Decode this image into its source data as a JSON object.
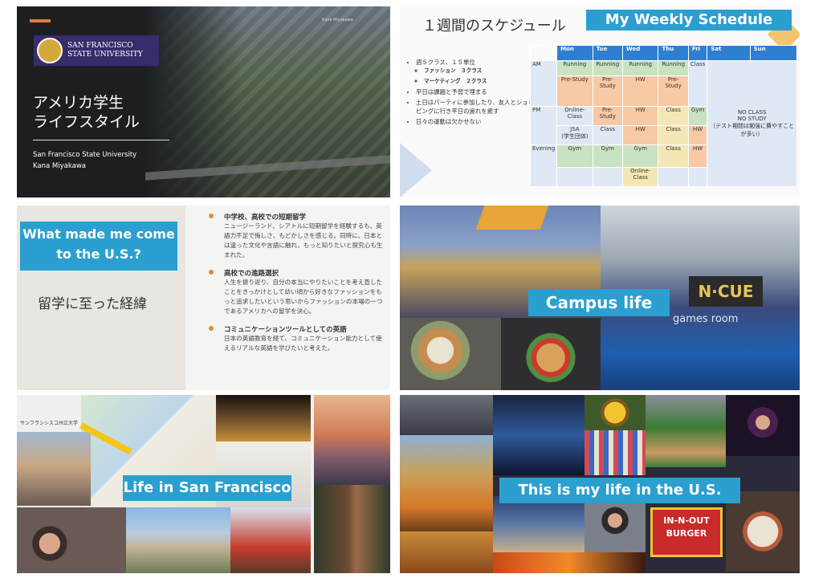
{
  "slide1": {
    "university_logo": "SAN FRANCISCO\nSTATE UNIVERSITY",
    "title": "アメリカ学生\nライフスタイル",
    "subtitle": "San Francisco State University\nKana Miyakawa",
    "speaker_tag": "Kana Miyakawa"
  },
  "slide2": {
    "title_jp": "１週間のスケジュール",
    "title_en": "My Weekly Schedule",
    "bullets": [
      "週５クラス、１５単位",
      "平日は課題と予習で埋まる",
      "土日はパーティに参加したり、友人とショッピングに行き平日の疲れを癒す",
      "日々の運動は欠かせない"
    ],
    "sub_bullets": [
      "ファッション　３クラス",
      "マーケティング　２クラス"
    ],
    "days": [
      "Mon",
      "Tue",
      "Wed",
      "Thu",
      "Fri",
      "Sat",
      "Sun"
    ],
    "periods": [
      "AM",
      "PM",
      "Evening"
    ],
    "rows": [
      [
        "Running",
        "Running",
        "Running",
        "Running",
        "Class"
      ],
      [
        "Pre-Study",
        "Pre-Study",
        "HW",
        "Pre-Study",
        ""
      ],
      [
        "Online-Class",
        "Pre-Study",
        "HW",
        "Class",
        "Gym"
      ],
      [
        "JSA\n(学生団体)",
        "Class",
        "HW",
        "Class",
        "HW"
      ],
      [
        "Gym",
        "Gym",
        "Gym",
        "Class",
        "HW"
      ],
      [
        "",
        "",
        "Online-Class",
        "",
        ""
      ]
    ],
    "weekend_note": "NO CLASS\nNO STUDY\n（テスト期間は勉強に費やすことが多い）"
  },
  "slide3": {
    "question": "What made me come to the U.S.?",
    "subtitle": "留学に至った経緯",
    "sections": [
      {
        "heading": "中学校、高校での短期留学",
        "body": "ニュージーランド、シアトルに短期留学を経験するも、英語力不足で悔しさ、もどかしさを感じる。同時に、日本とは違った文化や言語に触れ、もっと知りたいと探究心も生まれた。"
      },
      {
        "heading": "高校での進路選択",
        "body": "人生を振り返り、自分の本当にやりたいことを考え直したことをきっかけとして幼い頃から好きなファッションをもっと追求したいという思いからファッションの本場の一つであるアメリカへの留学を決心。"
      },
      {
        "heading": "コミュニケーションツールとしての英語",
        "body": "日本の英語教育を経て、コミュニケーション能力として使えるリアルな英語を学びたいと考えた。"
      }
    ]
  },
  "slide4": {
    "caption": "Campus life",
    "sign": "N·CUE",
    "sign_sub": "games room"
  },
  "slide5": {
    "caption": "Life in San Francisco",
    "map_label": "サンフランシスコ州立大学"
  },
  "slide6": {
    "caption": "This is my life in the U.S.",
    "burger_sign": "IN-N-OUT\nBURGER"
  },
  "colors": {
    "accent_blue": "#2b9fcf",
    "accent_orange": "#e07b39",
    "header_blue": "#2f7fd1"
  }
}
